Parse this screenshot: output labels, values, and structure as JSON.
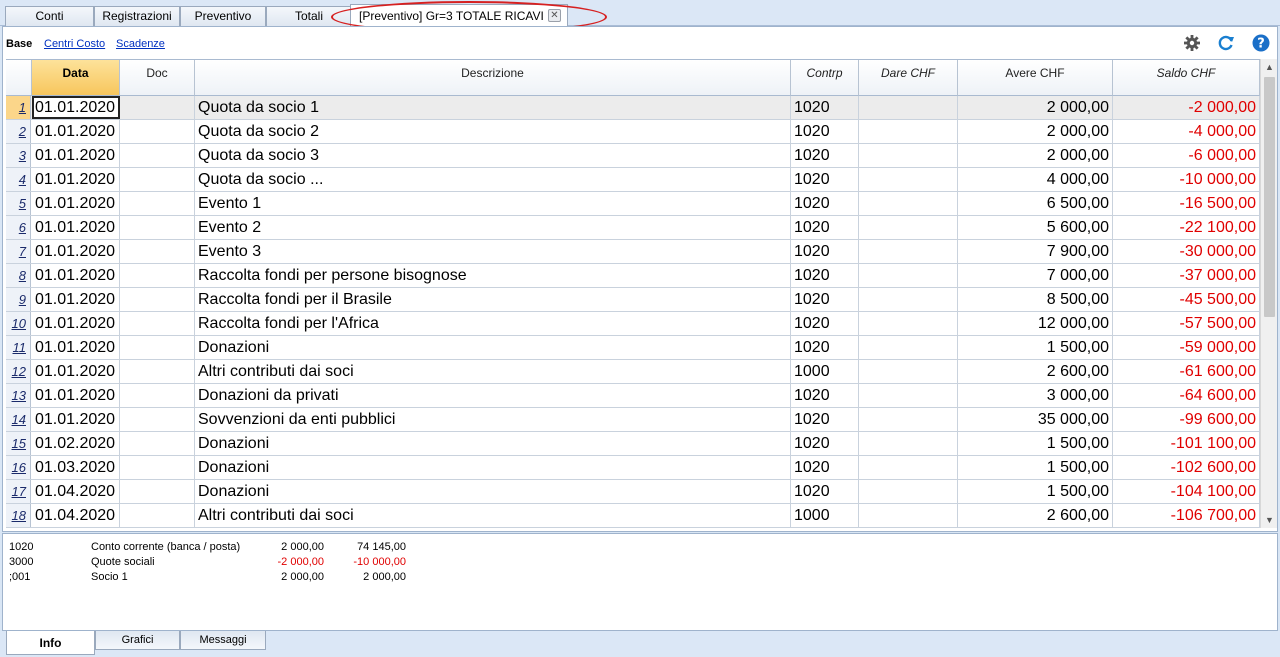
{
  "top_tabs": [
    "Conti",
    "Registrazioni",
    "Preventivo",
    "Totali",
    "[Preventivo] Gr=3 TOTALE RICAVI"
  ],
  "views": {
    "base": "Base",
    "links": [
      "Centri Costo",
      "Scadenze"
    ]
  },
  "toolbar": {
    "settings_icon": "gear-icon",
    "refresh_icon": "refresh-icon",
    "help_icon": "help-icon",
    "help_glyph": "?"
  },
  "columns": [
    "Data",
    "Doc",
    "Descrizione",
    "Contrp",
    "Dare CHF",
    "Avere CHF",
    "Saldo CHF"
  ],
  "rows": [
    {
      "n": "1",
      "data": "01.01.2020",
      "doc": "",
      "desc": "Quota da socio 1",
      "contrp": "1020",
      "dare": "",
      "avere": "2 000,00",
      "saldo": "-2 000,00"
    },
    {
      "n": "2",
      "data": "01.01.2020",
      "doc": "",
      "desc": "Quota da socio 2",
      "contrp": "1020",
      "dare": "",
      "avere": "2 000,00",
      "saldo": "-4 000,00"
    },
    {
      "n": "3",
      "data": "01.01.2020",
      "doc": "",
      "desc": "Quota da socio 3",
      "contrp": "1020",
      "dare": "",
      "avere": "2 000,00",
      "saldo": "-6 000,00"
    },
    {
      "n": "4",
      "data": "01.01.2020",
      "doc": "",
      "desc": "Quota da socio ...",
      "contrp": "1020",
      "dare": "",
      "avere": "4 000,00",
      "saldo": "-10 000,00"
    },
    {
      "n": "5",
      "data": "01.01.2020",
      "doc": "",
      "desc": "Evento 1",
      "contrp": "1020",
      "dare": "",
      "avere": "6 500,00",
      "saldo": "-16 500,00"
    },
    {
      "n": "6",
      "data": "01.01.2020",
      "doc": "",
      "desc": "Evento 2",
      "contrp": "1020",
      "dare": "",
      "avere": "5 600,00",
      "saldo": "-22 100,00"
    },
    {
      "n": "7",
      "data": "01.01.2020",
      "doc": "",
      "desc": "Evento 3",
      "contrp": "1020",
      "dare": "",
      "avere": "7 900,00",
      "saldo": "-30 000,00"
    },
    {
      "n": "8",
      "data": "01.01.2020",
      "doc": "",
      "desc": "Raccolta fondi per persone bisognose",
      "contrp": "1020",
      "dare": "",
      "avere": "7 000,00",
      "saldo": "-37 000,00"
    },
    {
      "n": "9",
      "data": "01.01.2020",
      "doc": "",
      "desc": "Raccolta fondi per il Brasile",
      "contrp": "1020",
      "dare": "",
      "avere": "8 500,00",
      "saldo": "-45 500,00"
    },
    {
      "n": "10",
      "data": "01.01.2020",
      "doc": "",
      "desc": "Raccolta fondi per l'Africa",
      "contrp": "1020",
      "dare": "",
      "avere": "12 000,00",
      "saldo": "-57 500,00"
    },
    {
      "n": "11",
      "data": "01.01.2020",
      "doc": "",
      "desc": "Donazioni",
      "contrp": "1020",
      "dare": "",
      "avere": "1 500,00",
      "saldo": "-59 000,00"
    },
    {
      "n": "12",
      "data": "01.01.2020",
      "doc": "",
      "desc": "Altri contributi dai soci",
      "contrp": "1000",
      "dare": "",
      "avere": "2 600,00",
      "saldo": "-61 600,00"
    },
    {
      "n": "13",
      "data": "01.01.2020",
      "doc": "",
      "desc": "Donazioni da privati",
      "contrp": "1020",
      "dare": "",
      "avere": "3 000,00",
      "saldo": "-64 600,00"
    },
    {
      "n": "14",
      "data": "01.01.2020",
      "doc": "",
      "desc": "Sovvenzioni da enti pubblici",
      "contrp": "1020",
      "dare": "",
      "avere": "35 000,00",
      "saldo": "-99 600,00"
    },
    {
      "n": "15",
      "data": "01.02.2020",
      "doc": "",
      "desc": "Donazioni",
      "contrp": "1020",
      "dare": "",
      "avere": "1 500,00",
      "saldo": "-101 100,00"
    },
    {
      "n": "16",
      "data": "01.03.2020",
      "doc": "",
      "desc": "Donazioni",
      "contrp": "1020",
      "dare": "",
      "avere": "1 500,00",
      "saldo": "-102 600,00"
    },
    {
      "n": "17",
      "data": "01.04.2020",
      "doc": "",
      "desc": "Donazioni",
      "contrp": "1020",
      "dare": "",
      "avere": "1 500,00",
      "saldo": "-104 100,00"
    },
    {
      "n": "18",
      "data": "01.04.2020",
      "doc": "",
      "desc": "Altri contributi dai soci",
      "contrp": "1000",
      "dare": "",
      "avere": "2 600,00",
      "saldo": "-106 700,00"
    }
  ],
  "info_lines": [
    {
      "account": "1020",
      "description": "Conto corrente (banca / posta)",
      "amount": "2 000,00",
      "balance": "74 145,00",
      "negative": false
    },
    {
      "account": "3000",
      "description": "Quote sociali",
      "amount": "-2 000,00",
      "balance": "-10 000,00",
      "negative": true
    },
    {
      "account": ";001",
      "description": "Socio 1",
      "amount": "2 000,00",
      "balance": "2 000,00",
      "negative": false
    }
  ],
  "bottom_tabs": [
    "Info",
    "Grafici",
    "Messaggi"
  ],
  "colors": {
    "negative": "#e00000",
    "highlight_ellipse": "#d62020",
    "active_header": "#f7c65d"
  }
}
